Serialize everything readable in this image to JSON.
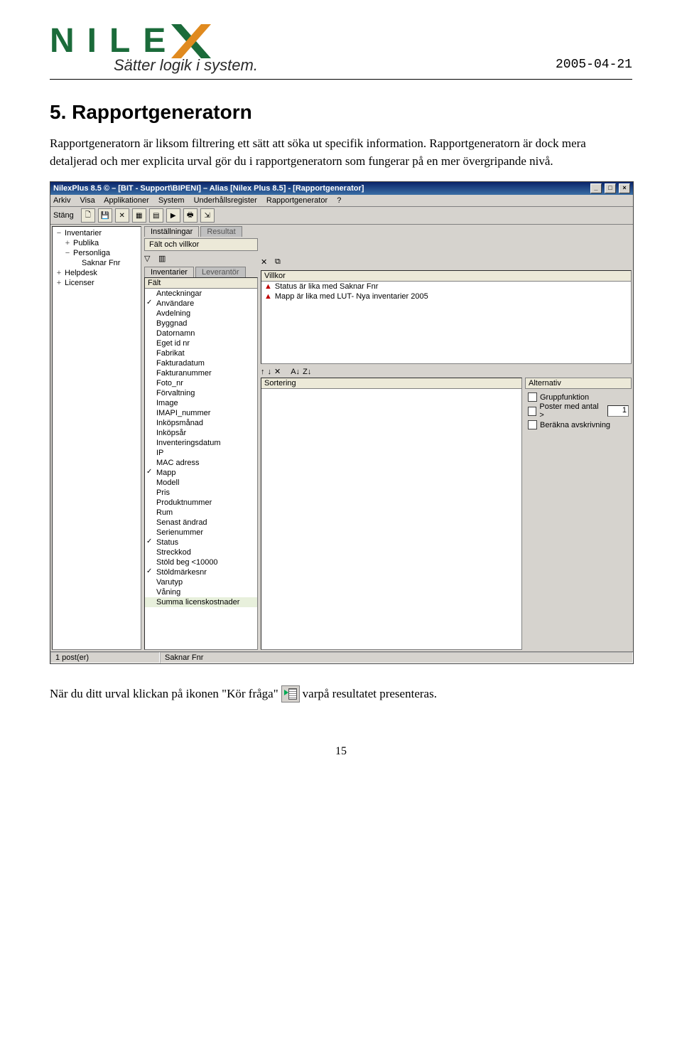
{
  "header": {
    "logo_text": "NILE",
    "tagline": "Sätter logik i system.",
    "date": "2005-04-21"
  },
  "doc": {
    "heading": "5.   Rapportgeneratorn",
    "para1": "Rapportgeneratorn är liksom filtrering ett sätt att söka ut specifik information. Rapportgeneratorn är  dock mera detaljerad och mer explicita urval gör du i rapportgeneratorn som fungerar på en mer övergripande nivå.",
    "after_a": "När du ditt urval  klickan på ikonen \"Kör fråga\"",
    "after_b": "varpå resultatet presenteras.",
    "page_number": "15"
  },
  "app": {
    "title": "NilexPlus 8.5 © – [BIT - Support\\BIPENI] – Alias [Nilex Plus 8.5] - [Rapportgenerator]",
    "menu": [
      "Arkiv",
      "Visa",
      "Applikationer",
      "System",
      "Underhållsregister",
      "Rapportgenerator",
      "?"
    ],
    "toolbar_label": "Stäng",
    "tree": [
      {
        "lvl": 0,
        "icon": "−",
        "label": "Inventarier"
      },
      {
        "lvl": 1,
        "icon": "+",
        "label": "Publika"
      },
      {
        "lvl": 1,
        "icon": "−",
        "label": "Personliga"
      },
      {
        "lvl": 2,
        "icon": "",
        "label": "Saknar Fnr"
      },
      {
        "lvl": 0,
        "icon": "+",
        "label": "Helpdesk"
      },
      {
        "lvl": 0,
        "icon": "+",
        "label": "Licenser"
      }
    ],
    "tabs_top": {
      "active": "Inställningar",
      "inactive": "Resultat"
    },
    "subbox": "Fält och villkor",
    "tabs_fields": {
      "active": "Inventarier",
      "inactive": "Leverantör"
    },
    "field_header": "Fält",
    "fields": [
      {
        "label": "Anteckningar",
        "checked": false
      },
      {
        "label": "Användare",
        "checked": true
      },
      {
        "label": "Avdelning",
        "checked": false
      },
      {
        "label": "Byggnad",
        "checked": false
      },
      {
        "label": "Datornamn",
        "checked": false
      },
      {
        "label": "Eget id nr",
        "checked": false
      },
      {
        "label": "Fabrikat",
        "checked": false
      },
      {
        "label": "Fakturadatum",
        "checked": false
      },
      {
        "label": "Fakturanummer",
        "checked": false
      },
      {
        "label": "Foto_nr",
        "checked": false
      },
      {
        "label": "Förvaltning",
        "checked": false
      },
      {
        "label": "Image",
        "checked": false
      },
      {
        "label": "IMAPI_nummer",
        "checked": false
      },
      {
        "label": "Inköpsmånad",
        "checked": false
      },
      {
        "label": "Inköpsår",
        "checked": false
      },
      {
        "label": "Inventeringsdatum",
        "checked": false
      },
      {
        "label": "IP",
        "checked": false
      },
      {
        "label": "MAC adress",
        "checked": false
      },
      {
        "label": "Mapp",
        "checked": true
      },
      {
        "label": "Modell",
        "checked": false
      },
      {
        "label": "Pris",
        "checked": false
      },
      {
        "label": "Produktnummer",
        "checked": false
      },
      {
        "label": "Rum",
        "checked": false
      },
      {
        "label": "Senast ändrad",
        "checked": false
      },
      {
        "label": "Serienummer",
        "checked": false
      },
      {
        "label": "Status",
        "checked": true
      },
      {
        "label": "Streckkod",
        "checked": false
      },
      {
        "label": "Stöld beg <10000",
        "checked": false
      },
      {
        "label": "Stöldmärkesnr",
        "checked": true
      },
      {
        "label": "Varutyp",
        "checked": false
      },
      {
        "label": "Våning",
        "checked": false
      },
      {
        "label": "Summa licenskostnader",
        "checked": false,
        "alt": true
      }
    ],
    "cond_header": "Villkor",
    "conditions": [
      "Status är lika med Saknar Fnr",
      "Mapp är lika med LUT- Nya inventarier 2005"
    ],
    "sort_header": "Sortering",
    "alt_header": "Alternativ",
    "alt_options": {
      "group": "Gruppfunktion",
      "posts": "Poster med antal >",
      "posts_value": "1",
      "calc": "Beräkna avskrivning"
    },
    "status": {
      "left": "1 post(er)",
      "mid": "Saknar Fnr"
    }
  }
}
